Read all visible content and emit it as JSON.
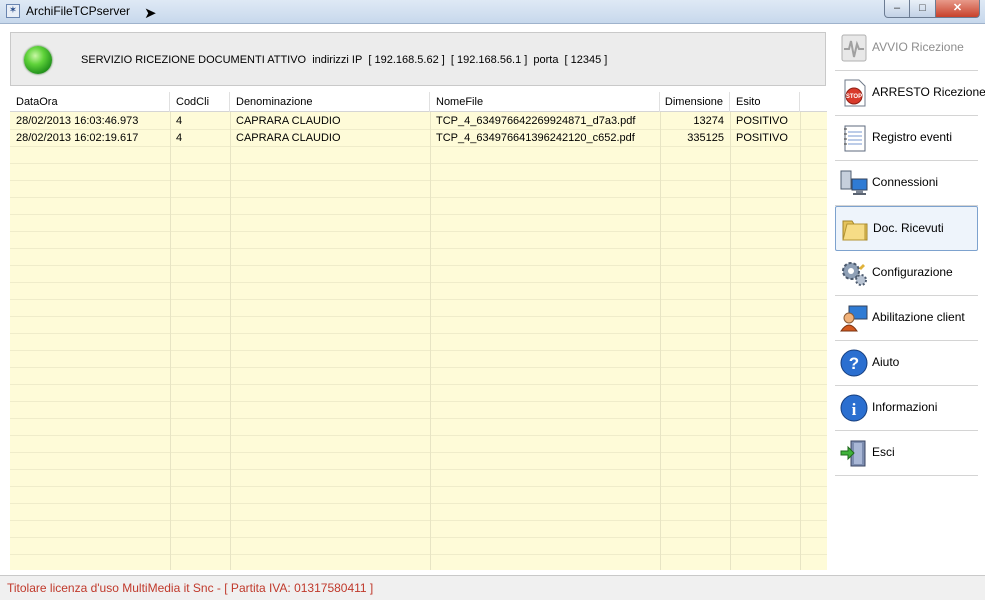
{
  "window": {
    "title": "ArchiFileTCPserver",
    "minimize": "–",
    "maximize": "□",
    "close": "✕"
  },
  "status": {
    "led_color": "#3cbf2a",
    "service_text": "SERVIZIO RICEZIONE DOCUMENTI ATTIVO",
    "ip_label": "indirizzi IP",
    "ip1": "[ 192.168.5.62 ]",
    "ip2": "[ 192.168.56.1 ]",
    "port_label": "porta",
    "port": "[ 12345 ]"
  },
  "table": {
    "columns": [
      "DataOra",
      "CodCli",
      "Denominazione",
      "NomeFile",
      "Dimensione",
      "Esito"
    ],
    "rows": [
      {
        "dataora": "28/02/2013 16:03:46.973",
        "codcli": "4",
        "denominazione": "CAPRARA CLAUDIO",
        "nomefile": "TCP_4_634976642269924871_d7a3.pdf",
        "dimensione": "13274",
        "esito": "POSITIVO"
      },
      {
        "dataora": "28/02/2013 16:02:19.617",
        "codcli": "4",
        "denominazione": "CAPRARA CLAUDIO",
        "nomefile": "TCP_4_634976641396242120_c652.pdf",
        "dimensione": "335125",
        "esito": "POSITIVO"
      }
    ],
    "row_background": "#fefbd8"
  },
  "sidebar": {
    "items": [
      {
        "label": "AVVIO Ricezione",
        "icon": "waveform-icon",
        "enabled": false
      },
      {
        "label": "ARRESTO Ricezione",
        "icon": "stop-icon",
        "enabled": true
      },
      {
        "label": "Registro eventi",
        "icon": "notebook-icon",
        "enabled": true
      },
      {
        "label": "Connessioni",
        "icon": "network-computers-icon",
        "enabled": true
      },
      {
        "label": "Doc. Ricevuti",
        "icon": "folder-icon",
        "enabled": true,
        "active": true
      },
      {
        "label": "Configurazione",
        "icon": "gears-icon",
        "enabled": true
      },
      {
        "label": "Abilitazione client",
        "icon": "user-computer-icon",
        "enabled": true
      },
      {
        "label": "Aiuto",
        "icon": "help-icon",
        "enabled": true
      },
      {
        "label": "Informazioni",
        "icon": "info-icon",
        "enabled": true
      },
      {
        "label": "Esci",
        "icon": "exit-door-icon",
        "enabled": true
      }
    ]
  },
  "footer": {
    "license_text": "Titolare licenza d'uso MultiMedia it Snc  - [ Partita IVA: 01317580411 ]",
    "text_color": "#c0392b"
  }
}
